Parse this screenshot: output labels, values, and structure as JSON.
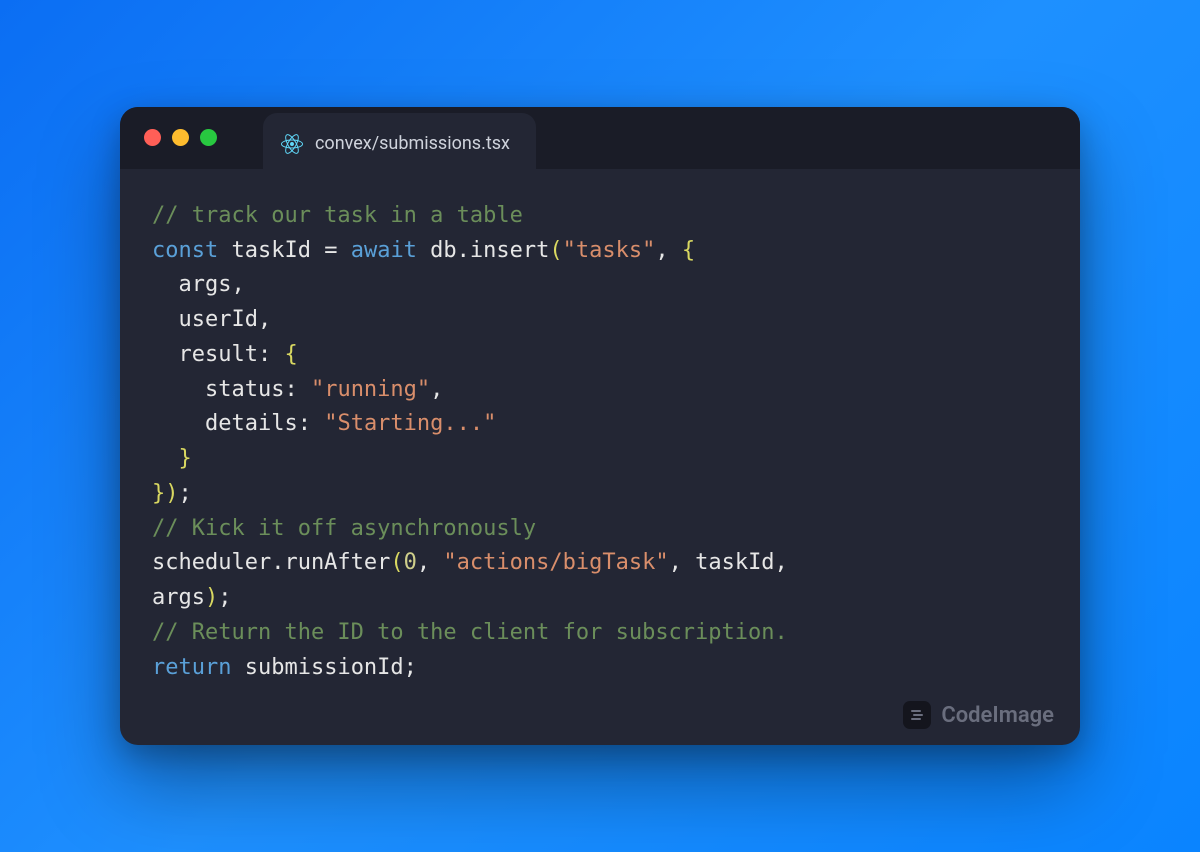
{
  "tab": {
    "filename": "convex/submissions.tsx"
  },
  "watermark": {
    "label": "CodeImage"
  },
  "code": {
    "l1_comment": "// track our task in a table",
    "l2_const": "const",
    "l2_taskId": " taskId ",
    "l2_eq": "= ",
    "l2_await": "await",
    "l2_dbinsert": " db.insert",
    "l2_paren_open": "(",
    "l2_str_tasks": "\"tasks\"",
    "l2_comma": ", ",
    "l2_brace_open": "{",
    "l3_args": "  args",
    "l3_comma": ",",
    "l4_userId": "  userId",
    "l4_comma": ",",
    "l5_result": "  result",
    "l5_colon": ": ",
    "l5_brace": "{",
    "l6_status": "    status",
    "l6_colon": ": ",
    "l6_str": "\"running\"",
    "l6_comma": ",",
    "l7_details": "    details",
    "l7_colon": ": ",
    "l7_str": "\"Starting...\"",
    "l8_brace": "  }",
    "l9_close": "}",
    "l9_paren": ")",
    "l9_semi": ";",
    "l10_comment": "// Kick it off asynchronously",
    "l11_scheduler": "scheduler.runAfter",
    "l11_paren_open": "(",
    "l11_zero": "0",
    "l11_c1": ", ",
    "l11_str": "\"actions/bigTask\"",
    "l11_c2": ", taskId,",
    "l12_args": "args",
    "l12_paren": ")",
    "l12_semi": ";",
    "l13_comment": "// Return the ID to the client for subscription.",
    "l14_return": "return",
    "l14_sub": " submissionId",
    "l14_semi": ";"
  }
}
